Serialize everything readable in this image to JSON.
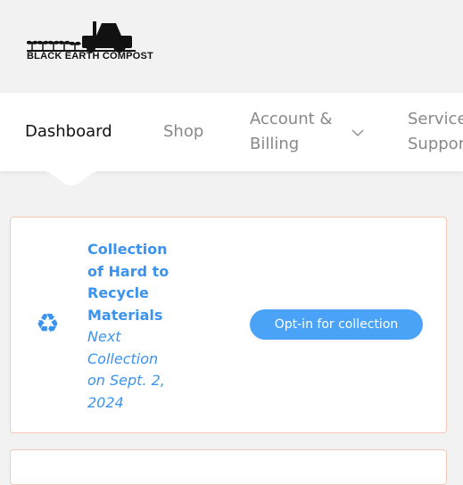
{
  "brand": {
    "logo_text": "BLACK EARTH COMPOST"
  },
  "nav": {
    "items": [
      {
        "label": "Dashboard",
        "active": true
      },
      {
        "label": "Shop"
      },
      {
        "label_line1": "Account &",
        "label_line2": "Billing",
        "icon": "chevron-down-icon"
      },
      {
        "label_line1": "Services &",
        "label_line2": "Support"
      }
    ]
  },
  "collection_card": {
    "icon": "recycle-icon",
    "title_lines": [
      "Collection",
      "of Hard to",
      "Recycle",
      "Materials"
    ],
    "subtitle_lines": [
      "Next",
      "Collection",
      "on Sept. 2,",
      "2024"
    ],
    "button_label": "Opt-in for collection"
  },
  "colors": {
    "accent": "#3a93ee",
    "button": "#4aa3f7",
    "card_border": "#f0c9b9",
    "background": "#f2f2f2"
  }
}
